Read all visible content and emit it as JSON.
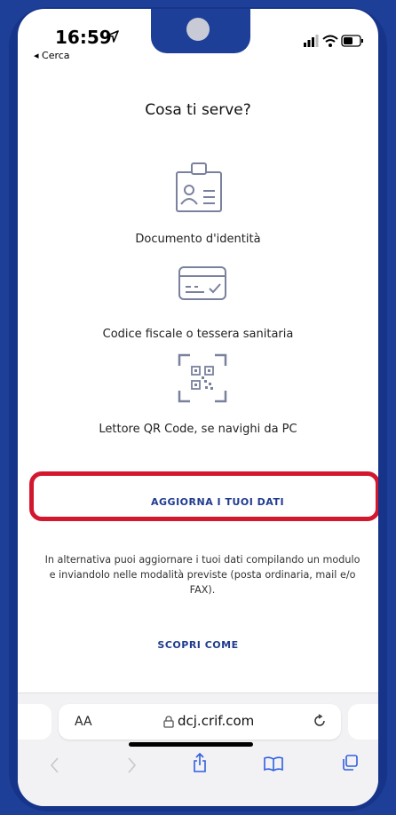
{
  "status_bar": {
    "time": "16:59",
    "back_label": "◂ Cerca"
  },
  "page": {
    "title": "Cosa ti serve?",
    "items": [
      {
        "icon": "id-badge-icon",
        "label": "Documento d'identità"
      },
      {
        "icon": "health-card-icon",
        "label": "Codice fiscale o tessera sanitaria"
      },
      {
        "icon": "qr-code-icon",
        "label": "Lettore QR Code, se navighi da PC"
      }
    ],
    "update_button": "AGGIORNA I TUOI DATI",
    "alternative_text": "In alternativa puoi aggiornare i tuoi dati compilando un modulo e inviandolo nelle modalità previste (posta ordinaria, mail e/o FAX).",
    "discover_link": "SCOPRI COME",
    "highlight_color": "#d3172e",
    "accent_color": "#1f3b8e"
  },
  "browser": {
    "text_size": "AA",
    "url": "dcj.crif.com"
  }
}
